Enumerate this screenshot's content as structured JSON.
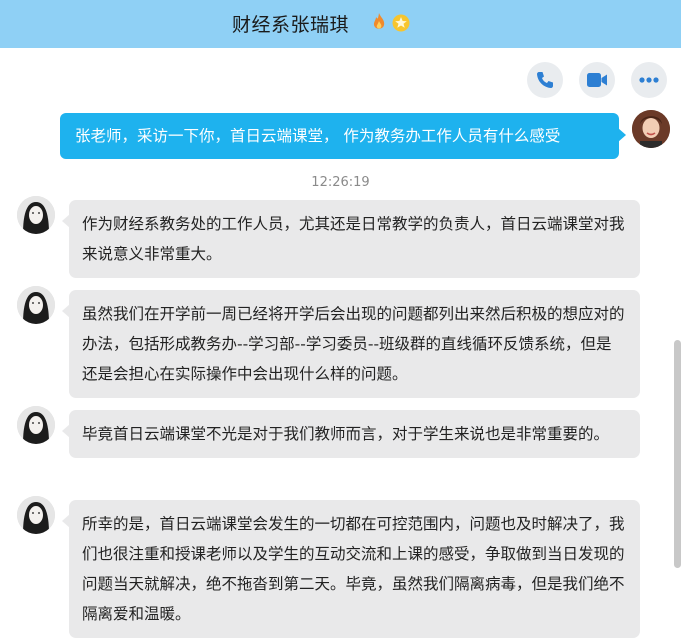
{
  "header": {
    "title": "财经系张瑞琪",
    "badges": [
      "fire-badge-icon",
      "star-badge-icon"
    ]
  },
  "actions": [
    {
      "name": "phone-icon",
      "color": "#2d7fd3"
    },
    {
      "name": "video-camera-icon",
      "color": "#2d7fd3"
    },
    {
      "name": "more-icon",
      "color": "#2d7fd3"
    }
  ],
  "colors": {
    "header_bg": "#8fd0f5",
    "outgoing_bubble": "#1eb2ee",
    "incoming_bubble": "#e9e9ea"
  },
  "outgoing": {
    "text": "张老师，采访一下你，首日云端课堂， 作为教务办工作人员有什么感受"
  },
  "timestamp": "12:26:19",
  "messages": [
    {
      "text": "作为财经系教务处的工作人员，尤其还是日常教学的负责人，首日云端课堂对我来说意义非常重大。"
    },
    {
      "text": "虽然我们在开学前一周已经将开学后会出现的问题都列出来然后积极的想应对的办法，包括形成教务办--学习部--学习委员--班级群的直线循环反馈系统，但是还是会担心在实际操作中会出现什么样的问题。"
    },
    {
      "text": "毕竟首日云端课堂不光是对于我们教师而言，对于学生来说也是非常重要的。"
    },
    {
      "text": "所幸的是，首日云端课堂会发生的一切都在可控范围内，问题也及时解决了，我们也很注重和授课老师以及学生的互动交流和上课的感受，争取做到当日发现的问题当天就解决，绝不拖沓到第二天。毕竟，虽然我们隔离病毒，但是我们绝不隔离爱和温暖。"
    }
  ]
}
